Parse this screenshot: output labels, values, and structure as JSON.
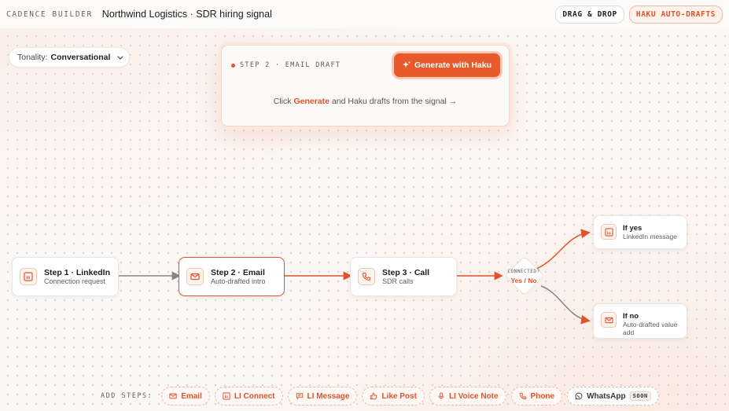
{
  "header": {
    "brand": "CADENCE BUILDER",
    "title": "Northwind Logistics · SDR hiring signal",
    "modes": [
      {
        "label": "DRAG & DROP",
        "active": false
      },
      {
        "label": "HAKU AUTO-DRAFTS",
        "active": true
      }
    ]
  },
  "tonality": {
    "label": "Tonality:",
    "value": "Conversational"
  },
  "draft_card": {
    "step_label": "STEP 2 · EMAIL DRAFT",
    "generate_button": "Generate with Haku",
    "hint_prefix": "Click",
    "hint_accent": "Generate",
    "hint_suffix": "and Haku drafts from the signal →"
  },
  "steps": [
    {
      "title": "Step 1 · LinkedIn",
      "subtitle": "Connection request",
      "icon": "linkedin-icon"
    },
    {
      "title": "Step 2 · Email",
      "subtitle": "Auto-drafted intro",
      "icon": "mail-icon",
      "selected": true
    },
    {
      "title": "Step 3 · Call",
      "subtitle": "SDR calls",
      "icon": "phone-icon"
    }
  ],
  "decision": {
    "label": "CONNECTED?",
    "value": "Yes / No"
  },
  "branches": {
    "yes": {
      "title": "If yes",
      "subtitle": "LinkedIn message",
      "icon": "linkedin-icon"
    },
    "no": {
      "title": "If no",
      "subtitle": "Auto-drafted value add",
      "icon": "mail-icon"
    }
  },
  "add_steps": {
    "label": "ADD STEPS:",
    "items": [
      {
        "label": "Email",
        "icon": "mail-icon"
      },
      {
        "label": "LI Connect",
        "icon": "linkedin-icon"
      },
      {
        "label": "LI Message",
        "icon": "message-icon"
      },
      {
        "label": "Like Post",
        "icon": "thumbs-up-icon"
      },
      {
        "label": "LI Voice Note",
        "icon": "microphone-icon"
      },
      {
        "label": "Phone",
        "icon": "phone-icon"
      },
      {
        "label": "WhatsApp",
        "icon": "whatsapp-icon",
        "badge": "SOON",
        "disabled": true
      }
    ]
  },
  "colors": {
    "accent": "#e0532b",
    "accent_button": "#e85a2c",
    "edge_inactive": "#8a8580"
  }
}
